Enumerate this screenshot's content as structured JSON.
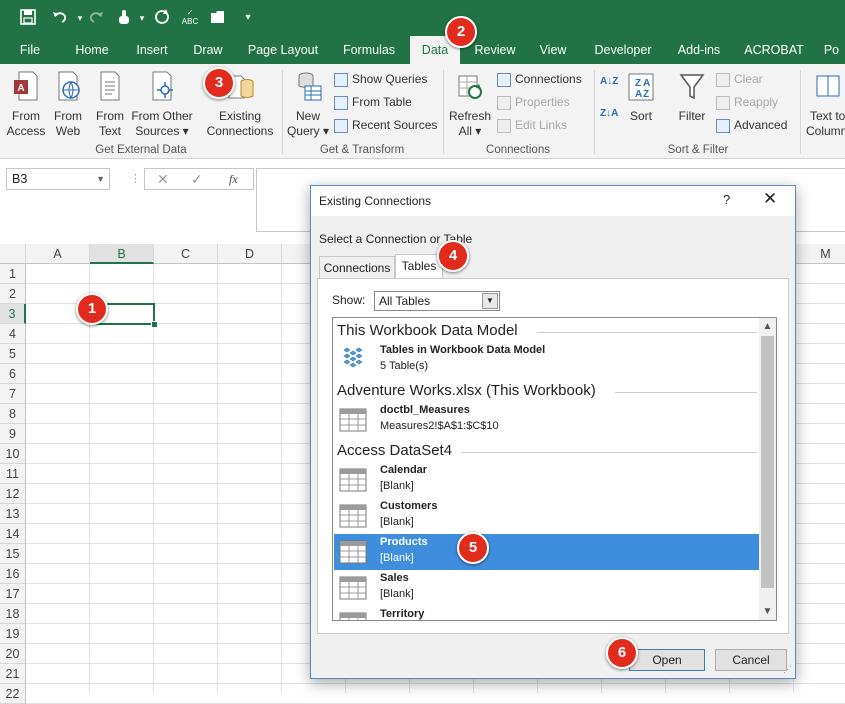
{
  "quick_access": {
    "icons": [
      "save-icon",
      "undo-icon",
      "redo-icon",
      "touch-mode-icon",
      "refresh-icon",
      "spelling-icon",
      "open-folder-icon",
      "customize-icon"
    ]
  },
  "tabs": [
    "File",
    "Home",
    "Insert",
    "Draw",
    "Page Layout",
    "Formulas",
    "Data",
    "Review",
    "View",
    "Developer",
    "Add-ins",
    "ACROBAT",
    "Po"
  ],
  "active_tab": "Data",
  "ribbon": {
    "from_access": [
      "From",
      "Access"
    ],
    "from_web": [
      "From",
      "Web"
    ],
    "from_text": [
      "From",
      "Text"
    ],
    "from_other": [
      "From Other",
      "Sources ▾"
    ],
    "existing": [
      "Existing",
      "Connections"
    ],
    "group_external": "Get External Data",
    "new_query": [
      "New",
      "Query ▾"
    ],
    "show_queries": "Show Queries",
    "from_table": "From Table",
    "recent_sources": "Recent Sources",
    "group_transform": "Get & Transform",
    "refresh_all": [
      "Refresh",
      "All ▾"
    ],
    "connections": "Connections",
    "properties": "Properties",
    "edit_links": "Edit Links",
    "group_connections": "Connections",
    "sort": "Sort",
    "filter": "Filter",
    "clear": "Clear",
    "reapply": "Reapply",
    "advanced": "Advanced",
    "group_sortfilter": "Sort & Filter",
    "text_to_columns": [
      "Text to",
      "Column"
    ]
  },
  "formula_bar": {
    "name_box": "B3",
    "fx": "fx"
  },
  "sheet": {
    "columns": [
      "A",
      "B",
      "C",
      "D",
      "M"
    ],
    "rows": [
      "1",
      "2",
      "3",
      "4",
      "5",
      "6",
      "7",
      "8",
      "9",
      "10",
      "11",
      "12",
      "13",
      "14",
      "15",
      "16",
      "17",
      "18",
      "19",
      "20",
      "21",
      "22"
    ],
    "selected_cell": "B3"
  },
  "dialog": {
    "title": "Existing Connections",
    "help": "?",
    "close": "✕",
    "prompt": "Select a Connection or Table",
    "tabs": [
      "Connections",
      "Tables"
    ],
    "show_label": "Show:",
    "show_value": "All Tables",
    "sections": [
      {
        "header": "This Workbook Data Model",
        "items": [
          {
            "name": "Tables in Workbook Data Model",
            "desc": "5 Table(s)",
            "icon": "data-model-icon"
          }
        ]
      },
      {
        "header": "Adventure Works.xlsx (This Workbook)",
        "items": [
          {
            "name": "doctbl_Measures",
            "desc": "Measures2!$A$1:$C$10",
            "icon": "table-icon"
          }
        ]
      },
      {
        "header": "Access DataSet4",
        "items": [
          {
            "name": "Calendar",
            "desc": "[Blank]",
            "icon": "table-icon"
          },
          {
            "name": "Customers",
            "desc": "[Blank]",
            "icon": "table-icon"
          },
          {
            "name": "Products",
            "desc": "[Blank]",
            "icon": "table-icon",
            "selected": true
          },
          {
            "name": "Sales",
            "desc": "[Blank]",
            "icon": "table-icon"
          },
          {
            "name": "Territory",
            "desc": "",
            "icon": "table-icon"
          }
        ]
      }
    ],
    "open_label": "Open",
    "cancel_label": "Cancel"
  },
  "callouts": [
    "1",
    "2",
    "3",
    "4",
    "5",
    "6"
  ],
  "colors": {
    "excel_green": "#217346",
    "selection_blue": "#3f8ede",
    "callout_red": "#e02b1d"
  }
}
